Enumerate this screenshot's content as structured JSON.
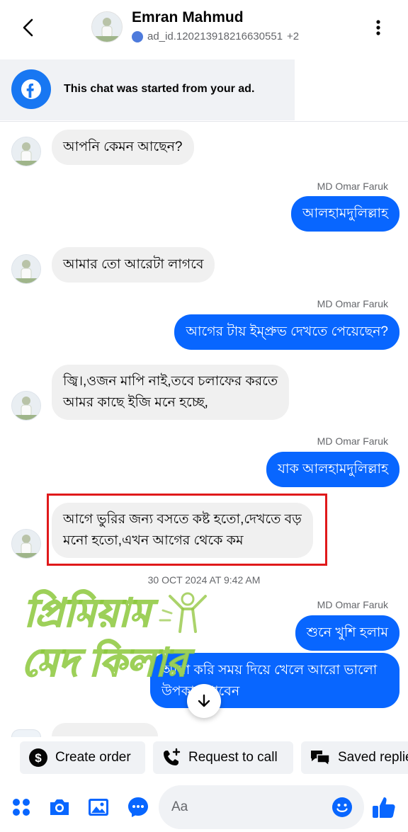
{
  "header": {
    "name": "Emran Mahmud",
    "subtitle": "ad_id.120213918216630551",
    "extra_count": "+2"
  },
  "ad_banner": {
    "text": "This chat was started from your ad."
  },
  "messages": [
    {
      "side": "in",
      "text": "আপনি কেমন আছেন?"
    },
    {
      "side": "out",
      "sender": "MD Omar Faruk",
      "text": "আলহামদুলিল্লাহ"
    },
    {
      "side": "in",
      "text": "আমার তো আরেটা লাগবে"
    },
    {
      "side": "out",
      "sender": "MD Omar Faruk",
      "text": "আগের টায় ইম্প্রুভ দেখতে পেয়েছেন?"
    },
    {
      "side": "in",
      "line1": "জ্বি।,ওজন মাপি নাই,তবে চলাফের করতে",
      "line2": "আমর কাছে ইজি মনে হচ্ছে,"
    },
    {
      "side": "out",
      "sender": "MD Omar Faruk",
      "text": "যাক আলহামদুলিল্লাহ"
    },
    {
      "side": "in",
      "line1": "আগে ভুরির জন্য বসতে কষ্ট হতো,দেখতে বড়",
      "line2": "মনো হতো,এখন আগের থেকে কম"
    },
    {
      "side": "out",
      "sender": "MD Omar Faruk",
      "text": "শুনে খুশি হলাম"
    },
    {
      "side": "out",
      "line1": "আসা করি সময় দিয়ে খেলে আরো ভালো",
      "line2": "উপকার পাবেন"
    }
  ],
  "timestamp": "30 OCT 2024 AT 9:42 AM",
  "watermark": {
    "line1": "প্রিমিয়াম",
    "line2": "মেদ কিলার"
  },
  "chips": [
    {
      "label": "Create order",
      "icon": "dollar-icon"
    },
    {
      "label": "Request to call",
      "icon": "phone-plus-icon"
    },
    {
      "label": "Saved replies",
      "icon": "saved-replies-icon"
    }
  ],
  "composer": {
    "placeholder": "Aa"
  },
  "colors": {
    "accent": "#0866ff",
    "incoming_bubble": "#f0f0f0",
    "highlight": "#e0191b"
  }
}
